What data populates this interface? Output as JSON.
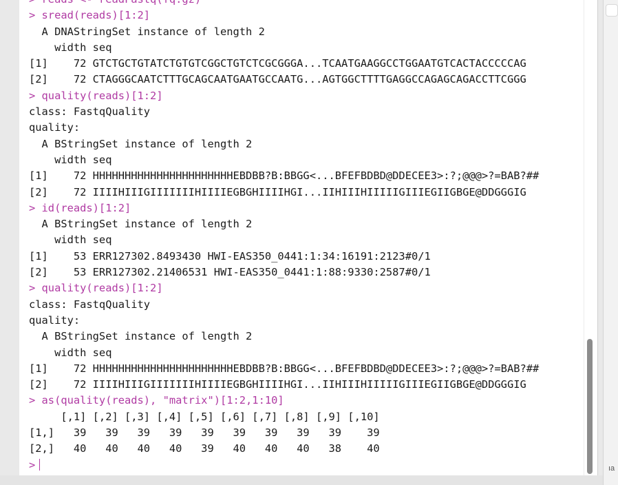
{
  "console": {
    "prompt_symbol": ">",
    "lines": [
      {
        "kind": "cmd",
        "text": "> reads <- readFastq(fq.gz)"
      },
      {
        "kind": "cmd",
        "text": "> sread(reads)[1:2]"
      },
      {
        "kind": "out",
        "text": "  A DNAStringSet instance of length 2"
      },
      {
        "kind": "out",
        "text": "    width seq"
      },
      {
        "kind": "out",
        "text": "[1]    72 GTCTGCTGTATCTGTGTCGGCTGTCTCGCGGGA...TCAATGAAGGCCTGGAATGTCACTACCCCCAG"
      },
      {
        "kind": "out",
        "text": "[2]    72 CTAGGGCAATCTTTGCAGCAATGAATGCCAATG...AGTGGCTTTTGAGGCCAGAGCAGACCTTCGGG"
      },
      {
        "kind": "cmd",
        "text": "> quality(reads)[1:2]"
      },
      {
        "kind": "out",
        "text": "class: FastqQuality"
      },
      {
        "kind": "out",
        "text": "quality:"
      },
      {
        "kind": "out",
        "text": "  A BStringSet instance of length 2"
      },
      {
        "kind": "out",
        "text": "    width seq"
      },
      {
        "kind": "out",
        "text": "[1]    72 HHHHHHHHHHHHHHHHHHHHHHEBDBB?B:BBGG<...BFEFBDBD@DDECEE3>:?;@@@>?=BAB?##"
      },
      {
        "kind": "out",
        "text": "[2]    72 IIIIHIIIGIIIIIIIHIIIIEGBGHIIIIHGI...IIHIIIHIIIIIGIIIEGIIGBGE@DDGGGIG"
      },
      {
        "kind": "cmd",
        "text": "> id(reads)[1:2]"
      },
      {
        "kind": "out",
        "text": "  A BStringSet instance of length 2"
      },
      {
        "kind": "out",
        "text": "    width seq"
      },
      {
        "kind": "out",
        "text": "[1]    53 ERR127302.8493430 HWI-EAS350_0441:1:34:16191:2123#0/1"
      },
      {
        "kind": "out",
        "text": "[2]    53 ERR127302.21406531 HWI-EAS350_0441:1:88:9330:2587#0/1"
      },
      {
        "kind": "cmd",
        "text": "> quality(reads)[1:2]"
      },
      {
        "kind": "out",
        "text": "class: FastqQuality"
      },
      {
        "kind": "out",
        "text": "quality:"
      },
      {
        "kind": "out",
        "text": "  A BStringSet instance of length 2"
      },
      {
        "kind": "out",
        "text": "    width seq"
      },
      {
        "kind": "out",
        "text": "[1]    72 HHHHHHHHHHHHHHHHHHHHHHEBDBB?B:BBGG<...BFEFBDBD@DDECEE3>:?;@@@>?=BAB?##"
      },
      {
        "kind": "out",
        "text": "[2]    72 IIIIHIIIGIIIIIIIHIIIIEGBGHIIIIHGI...IIHIIIHIIIIIGIIIEGIIGBGE@DDGGGIG"
      },
      {
        "kind": "cmd",
        "text": "> as(quality(reads), \"matrix\")[1:2,1:10]"
      },
      {
        "kind": "out",
        "text": "     [,1] [,2] [,3] [,4] [,5] [,6] [,7] [,8] [,9] [,10]"
      },
      {
        "kind": "out",
        "text": "[1,]   39   39   39   39   39   39   39   39   39    39"
      },
      {
        "kind": "out",
        "text": "[2,]   40   40   40   40   39   40   40   40   38    40"
      }
    ]
  },
  "side_panel": {
    "label": "ıa"
  },
  "colors": {
    "command": "#b03aa3",
    "output": "#1a1a1a",
    "background": "#ffffff",
    "scroll_thumb": "#8c8c8c"
  }
}
